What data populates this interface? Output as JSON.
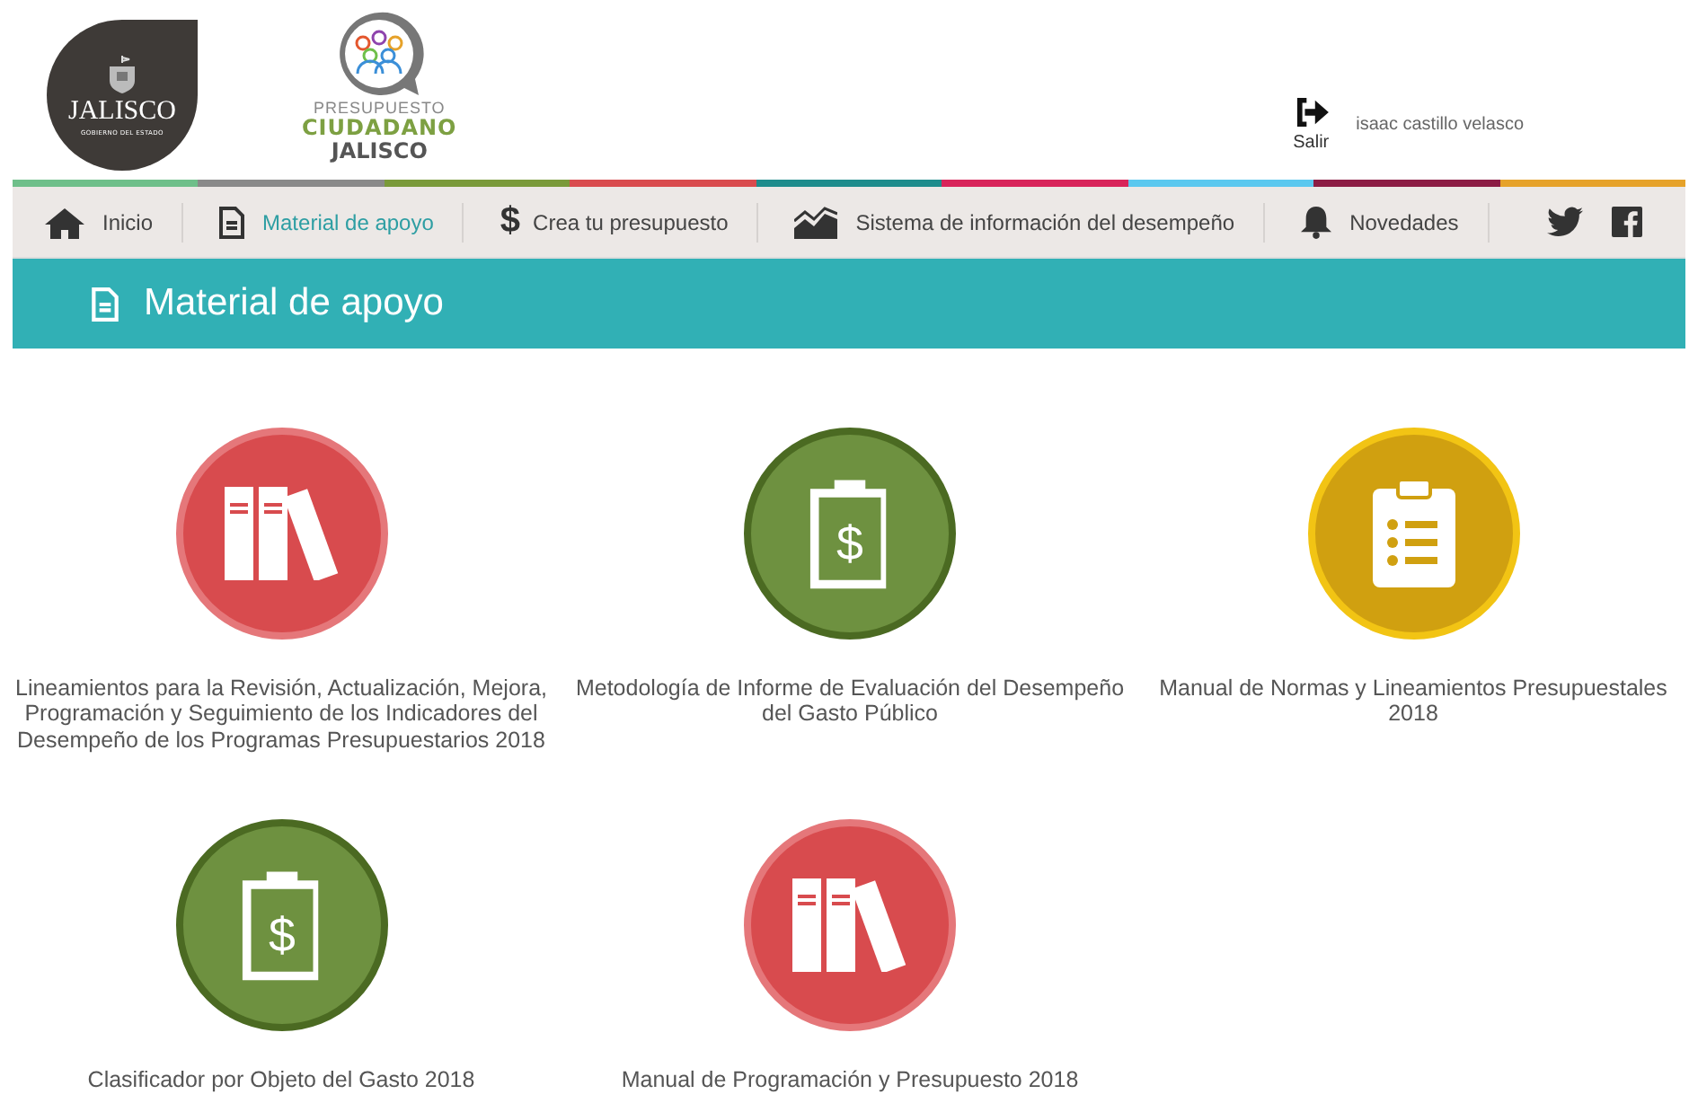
{
  "header": {
    "state_logo": {
      "name": "JALISCO",
      "subtitle": "GOBIERNO DEL ESTADO"
    },
    "program_logo": {
      "line_1": "PRESUPUESTO",
      "line_2": "CIUDADANO",
      "line_3": "JALISCO"
    },
    "logout": {
      "label": "Salir"
    },
    "user_name": "isaac castillo velasco"
  },
  "nav": [
    {
      "kind": "home",
      "label": "Inicio",
      "selected": false
    },
    {
      "kind": "document",
      "label": "Material de apoyo",
      "selected": true
    },
    {
      "kind": "dollar",
      "icon": "$",
      "label": "Crea tu presupuesto",
      "selected": false
    },
    {
      "kind": "chart",
      "label": "Sistema de información del desempeño",
      "selected": false
    },
    {
      "kind": "bell",
      "label": "Novedades",
      "selected": false
    }
  ],
  "banner": {
    "title": "Material de apoyo"
  },
  "documents": [
    {
      "kind": "books",
      "color": "#d84b4e",
      "title": "Lineamientos para la Revisión, Actualización, Mejora, Programación y Seguimiento de los Indicadores del Desempeño de los Programas Presupuestarios 2018"
    },
    {
      "kind": "clipboard-dollar",
      "symbol": "$",
      "color": "#6e9140",
      "title": "Metodología de Informe de Evaluación del Desempeño del Gasto Público"
    },
    {
      "kind": "clipboard-list",
      "color": "#d0a010",
      "title": "Manual de Normas y Lineamientos Presupuestales 2018"
    },
    {
      "kind": "clipboard-dollar",
      "symbol": "$",
      "color": "#6e9140",
      "title": "Clasificador por Objeto del Gasto 2018"
    },
    {
      "kind": "books",
      "color": "#d84b4e",
      "title": "Manual de Programación y Presupuesto 2018"
    }
  ]
}
